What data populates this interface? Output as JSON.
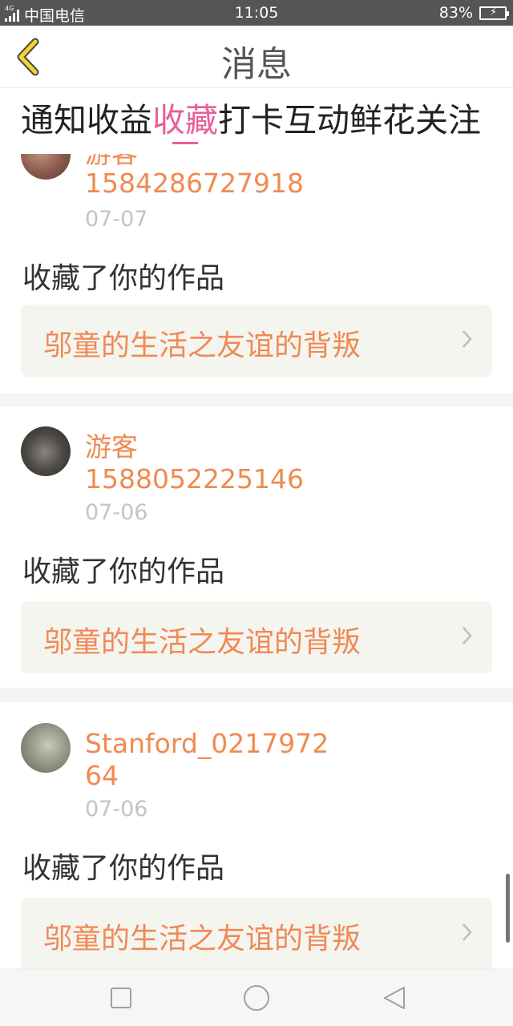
{
  "status_bar": {
    "network": "4G",
    "carrier": "中国电信",
    "time": "11:05",
    "battery": "83%",
    "battery_level": 0.83,
    "battery_color": "#3ed36a"
  },
  "header": {
    "title": "消息"
  },
  "tabs": [
    {
      "label": "通知",
      "active": false
    },
    {
      "label": "收益",
      "active": false
    },
    {
      "label": "收藏",
      "active": true
    },
    {
      "label": "打卡",
      "active": false
    },
    {
      "label": "互动",
      "active": false
    },
    {
      "label": "鲜花",
      "active": false
    },
    {
      "label": "关注",
      "active": false
    }
  ],
  "colors": {
    "accent": "#e8609a",
    "username": "#f08a50",
    "work_title": "#ef8a55"
  },
  "notifications": [
    {
      "username_partial": "游客",
      "user_id": "1584286727918",
      "date": "07-07",
      "action": "收藏了你的作品",
      "work_title": "邬童的生活之友谊的背叛"
    },
    {
      "username": "游客",
      "user_id": "1588052225146",
      "date": "07-06",
      "action": "收藏了你的作品",
      "work_title": "邬童的生活之友谊的背叛"
    },
    {
      "username": "Stanford_021797264",
      "date": "07-06",
      "action": "收藏了你的作品",
      "work_title": "邬童的生活之友谊的背叛"
    }
  ],
  "icons": {
    "back": "chevron-left-icon",
    "link": "chevron-right-icon",
    "nav_recent": "square-icon",
    "nav_home": "circle-icon",
    "nav_back": "triangle-left-icon"
  }
}
